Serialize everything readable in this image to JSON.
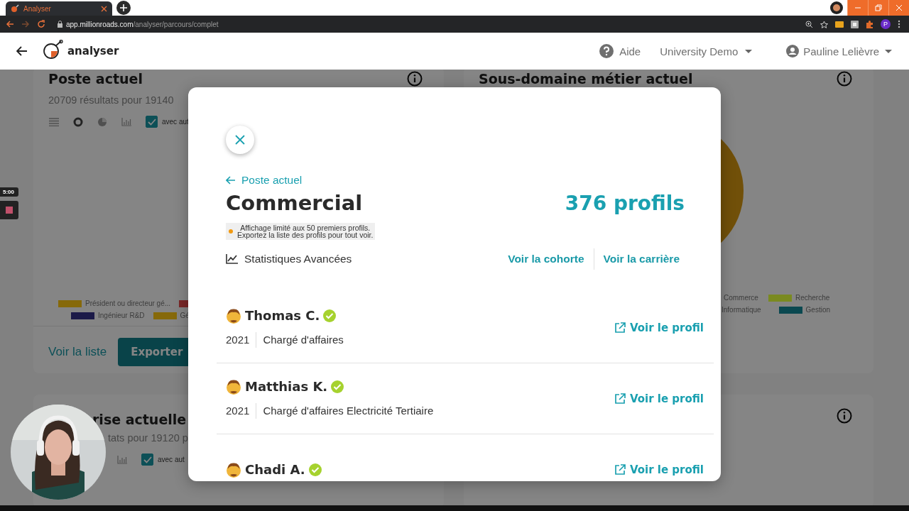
{
  "browser": {
    "tab": {
      "title": "Analyser"
    },
    "url": {
      "host": "app.millionroads.com",
      "path": "/analyser/parcours/complet"
    },
    "profile_initial": "P"
  },
  "header": {
    "app_name": "analyser",
    "help": "Aide",
    "organization": "University Demo",
    "user": "Pauline Lelièvre"
  },
  "current_position_card": {
    "title": "Poste actuel",
    "subtitle": "20709 résultats pour 19140",
    "with_others": {
      "label": "avec aut",
      "checked": true
    },
    "legend_rows": [
      [
        {
          "label": "Président ou directeur gé...",
          "color": "#86690a"
        },
        {
          "color": "#7a2828"
        }
      ],
      [
        {
          "label": "Ingénieur R&D",
          "color": "#1c1a48"
        },
        {
          "label": "Gé",
          "color": "#86690a"
        }
      ]
    ],
    "list_link": "Voir la liste",
    "export_button": "Exporter"
  },
  "subdomain_card": {
    "title": "Sous-domaine métier actuel",
    "legend_rows": [
      [
        {
          "label": "Commerce"
        },
        {
          "label": "Recherche",
          "color": "#7a8a20"
        }
      ],
      [
        {
          "label": "Informatique"
        },
        {
          "label": "Gestion",
          "color": "#0a4850"
        }
      ]
    ]
  },
  "company_card": {
    "title": "rise actuelle",
    "subtitle": "tats pour 19120 p",
    "with_others": {
      "label": "avec aut",
      "checked": true
    }
  },
  "recorder": {
    "time": "5:00"
  },
  "modal": {
    "back_link": "Poste actuel",
    "title": "Commercial",
    "count": "376 profils",
    "notice": [
      "Affichage limité aux 50 premiers profils.",
      "Exportez la liste des profils pour tout voir."
    ],
    "stats_link": "Statistiques Avancées",
    "links": [
      "Voir la cohorte",
      "Voir la carrière"
    ],
    "profiles": [
      {
        "name": "Thomas C.",
        "verified": true,
        "year": "2021",
        "position": "Chargé d'affaires",
        "link": "Voir le profil"
      },
      {
        "name": "Matthias K.",
        "verified": true,
        "year": "2021",
        "position": "Chargé d'affaires Electricité Tertiaire",
        "link": "Voir le profil"
      },
      {
        "name": "Chadi A.",
        "verified": true,
        "link": "Voir le profil"
      }
    ]
  }
}
